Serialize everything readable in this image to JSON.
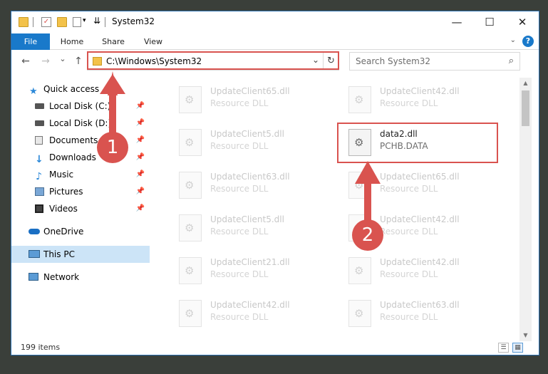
{
  "window": {
    "title": "System32",
    "minimize": "—",
    "maximize": "☐",
    "close": "✕"
  },
  "ribbon": {
    "tabs": [
      "File",
      "Home",
      "Share",
      "View"
    ],
    "help": "?"
  },
  "nav": {
    "back": "←",
    "forward": "→",
    "recent": "⌄",
    "up": "↑",
    "address": "C:\\Windows\\System32",
    "refresh": "↻",
    "search_placeholder": "Search System32"
  },
  "sidebar": {
    "items": [
      {
        "label": "Quick access",
        "icon": "star-icon",
        "pinned": false
      },
      {
        "label": "Local Disk (C:)",
        "icon": "drive-icon",
        "pinned": true
      },
      {
        "label": "Local Disk (D:)",
        "icon": "drive-icon",
        "pinned": true
      },
      {
        "label": "Documents",
        "icon": "documents-icon",
        "pinned": true
      },
      {
        "label": "Downloads",
        "icon": "downloads-icon",
        "pinned": true
      },
      {
        "label": "Music",
        "icon": "music-icon",
        "pinned": true
      },
      {
        "label": "Pictures",
        "icon": "pictures-icon",
        "pinned": true
      },
      {
        "label": "Videos",
        "icon": "videos-icon",
        "pinned": true
      },
      {
        "label": "OneDrive",
        "icon": "cloud-icon",
        "pinned": false
      },
      {
        "label": "This PC",
        "icon": "computer-icon",
        "pinned": false,
        "selected": true
      },
      {
        "label": "Network",
        "icon": "network-icon",
        "pinned": false
      }
    ]
  },
  "files": {
    "left": [
      {
        "name": "UpdateClient65.dll",
        "type": "Resource DLL"
      },
      {
        "name": "UpdateClient5.dll",
        "type": "Resource DLL"
      },
      {
        "name": "UpdateClient63.dll",
        "type": "Resource DLL"
      },
      {
        "name": "UpdateClient5.dll",
        "type": "Resource DLL"
      },
      {
        "name": "UpdateClient21.dll",
        "type": "Resource DLL"
      },
      {
        "name": "UpdateClient42.dll",
        "type": "Resource DLL"
      }
    ],
    "right": [
      {
        "name": "UpdateClient42.dll",
        "type": "Resource DLL"
      },
      {
        "name": "data2.dll",
        "type": "PCHB.DATA",
        "active": true
      },
      {
        "name": "UpdateClient65.dll",
        "type": "Resource DLL"
      },
      {
        "name": "UpdateClient42.dll",
        "type": "Resource DLL"
      },
      {
        "name": "UpdateClient42.dll",
        "type": "Resource DLL"
      },
      {
        "name": "UpdateClient63.dll",
        "type": "Resource DLL"
      }
    ]
  },
  "status": {
    "count": "199 items"
  },
  "annotations": {
    "step1": "1",
    "step2": "2",
    "color": "#d9534f"
  }
}
